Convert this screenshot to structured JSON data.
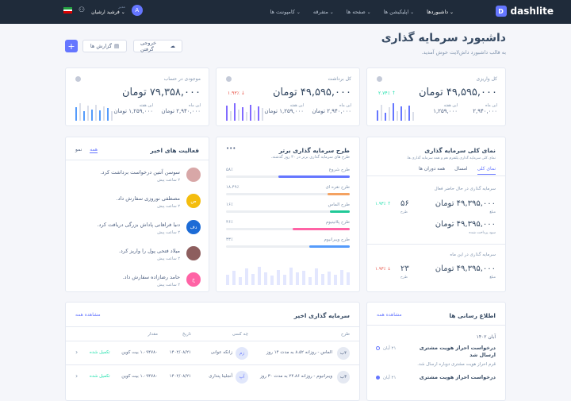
{
  "topbar": {
    "brand": "dashlite",
    "brand_initial": "D",
    "nav": [
      "داشبوردها",
      "اپلیکیشن ها",
      "صفحه ها",
      "متفرقه",
      "کامپوننت ها"
    ],
    "user_role": "مدیر",
    "user_name": "فرشید ارشیان",
    "avatar_initial": "A"
  },
  "page": {
    "title": "داشبورد سرمایه گذاری",
    "subtitle": "به قالب داشبورد داش‌لایت خوش آمدید.",
    "report_button": "گزارش ها",
    "export_button": "خروجی گرفتن",
    "add_button": "+"
  },
  "stats": [
    {
      "label": "کل واریزی",
      "value": "۴۹,۵۹۵,۰۰۰ تومان",
      "change": "۲.۷۴٪ ↑",
      "change_color": "#1ee0ac",
      "m1_label": "این ماه",
      "m1_value": "۲,۹۴۰,۰۰۰",
      "m2_label": "این هفته",
      "m2_value": "۱,۲۵۹,۰۰۰",
      "bar_color": "#6576ff",
      "bars": [
        0.55,
        0.85,
        0.4,
        0.7,
        0.9,
        0.5,
        0.75,
        0.6,
        0.8,
        0.45
      ]
    },
    {
      "label": "کل برداشت",
      "value": "۴۹,۵۹۵,۰۰۰ تومان",
      "change": "۱.۹۳٪ ↓",
      "change_color": "#e85347",
      "m1_label": "این ماه",
      "m1_value": "۲,۹۴۰,۰۰۰ تومان",
      "m2_label": "این هفته",
      "m2_value": "۱,۲۵۹,۰۰۰ تومان",
      "bar_color": "#816bff",
      "bars": [
        0.8,
        0.5,
        0.9,
        0.6,
        0.7,
        0.45,
        0.85,
        0.55,
        0.75,
        0.65
      ]
    },
    {
      "label": "موجودی در حساب",
      "value": "۷۹,۳۵۸,۰۰۰ تومان",
      "change": "",
      "change_color": "#1ee0ac",
      "m1_label": "این ماه",
      "m1_value": "۲,۹۴۰,۰۰۰ تومان",
      "m2_label": "این هفته",
      "m2_value": "۱,۲۵۹,۰۰۰ تومان",
      "bar_color": "#559bfb",
      "bars": [
        0.7,
        0.9,
        0.5,
        0.8,
        0.6,
        0.85,
        0.55,
        0.75,
        0.65,
        0.5
      ]
    }
  ],
  "overview": {
    "title": "نمای کلی سرمایه گذاری",
    "subtitle": "نمای کلی سرمایه گذاری پلتفرم هم و همه سرمایه گذاری ها.",
    "tabs": [
      "نمای کلی",
      "امسال",
      "همه دوران ها"
    ],
    "sec1": "سرمایه گذاری در حال حاضر فعال",
    "rows1": [
      {
        "value": "۴۹,۳۹۵,۰۰۰ تومان",
        "label": "مبلغ",
        "pct": "۵۶",
        "pct_label": "طرح",
        "change": "۱.۹۳٪ ↑",
        "change_color": "#1ee0ac"
      },
      {
        "value": "۴۹,۳۹۵,۰۰۰ تومان",
        "label": "سود پرداخت شده"
      }
    ],
    "sec2": "سرمایه گذاری در این ماه",
    "rows2": [
      {
        "value": "۴۹,۳۹۵,۰۰۰ تومان",
        "label": "مبلغ",
        "pct": "۲۳",
        "pct_label": "طرح",
        "change": "۱.۹۳٪ ↓",
        "change_color": "#e85347"
      }
    ]
  },
  "plans": {
    "title": "طرح سرمایه گذاری برتر",
    "subtitle": "طرح های سرمایه گذاری برتر در ۳۰ روز گذشته.",
    "more": "•••",
    "items": [
      {
        "name": "طرح شروع",
        "pct": "۵۸٪",
        "value": 0.58,
        "color": "#6576ff"
      },
      {
        "name": "طرح نقره ای",
        "pct": "۱۸.۴۹٪",
        "value": 0.18,
        "color": "#f4a261"
      },
      {
        "name": "طرح الماس",
        "pct": "۱۶٪",
        "value": 0.16,
        "color": "#20c997"
      },
      {
        "name": "طرح پلاتینیوم",
        "pct": "۴۶٪",
        "value": 0.46,
        "color": "#ff63a5"
      },
      {
        "name": "طرح ویبرانیوم",
        "pct": "۳۳٪",
        "value": 0.33,
        "color": "#559bfb"
      }
    ],
    "bars": [
      0.5,
      0.7,
      0.4,
      0.8,
      0.55,
      0.9,
      0.6,
      0.45,
      0.75,
      0.5,
      0.85,
      0.6,
      0.7,
      0.4,
      0.8,
      0.55,
      0.65,
      0.5,
      0.75,
      0.6
    ]
  },
  "activity": {
    "title": "فعالیت های اخیر",
    "tabs": [
      "همه",
      "نمو"
    ],
    "items": [
      {
        "text": "سوسن آنتین درخواست برداشت کرد.",
        "time": "۲ ساعت پیش",
        "initials": "",
        "color": "#d8a7a7"
      },
      {
        "text": "مصطفی نوروزی سفارش داد.",
        "time": "۲ ساعت پیش",
        "initials": "ص",
        "color": "#f4bd0e"
      },
      {
        "text": "دنیا فراهانی پاداش بزرگی دریافت کرد.",
        "time": "۲ ساعت پیش",
        "initials": "دف",
        "color": "#1c6bd6"
      },
      {
        "text": "میلاد فتحی پول را واریز کرد.",
        "time": "۲ ساعت پیش",
        "initials": "",
        "color": "#8d5e5e"
      },
      {
        "text": "حامد رضازاده سفارش داد.",
        "time": "۲ ساعت پیش",
        "initials": "خ",
        "color": "#ff63a5"
      }
    ]
  },
  "invest": {
    "title": "سرمایه گذاری اخیر",
    "view_all": "مشاهده همه",
    "cols": [
      "طرح",
      "چه کسی",
      "تاریخ",
      "مقدار"
    ],
    "rows": [
      {
        "plan": "الماس - روزانه ۸.۵۲ به مدت ۱۴ روز",
        "icon": "۴ب",
        "who": "زانکه عوانی",
        "who_i": "زم",
        "date": "۱۴۰۲/۰۸/۲۱",
        "amount": "۱.۰۹۴۷۸۰ بیت کوین",
        "status": "تکمیل شده"
      },
      {
        "plan": "ویبرانیوم - روزانه ۲۴.۸۶ به مدت ۳۰ روز",
        "icon": "۳ب",
        "who": "آنجلینا پنداری",
        "who_i": "آپ",
        "date": "۱۴۰۲/۰۸/۲۱",
        "amount": "۱.۰۹۴۷۸۰ بیت کوین",
        "status": "تکمیل شده"
      }
    ]
  },
  "notices": {
    "title": "اطلاع رسانی ها",
    "view_all": "مشاهده همه",
    "month": "آبان ۱۴۰۲",
    "items": [
      {
        "day": "۲۱ آبان",
        "title": "درخواست احراز هویت مشتری ارسال شد",
        "desc": "قرم احراز هویت مشتری دوباره ارسال شد."
      },
      {
        "day": "۲۱ آبان",
        "title": "درخواست احراز هویت مشتری",
        "desc": ""
      }
    ]
  }
}
